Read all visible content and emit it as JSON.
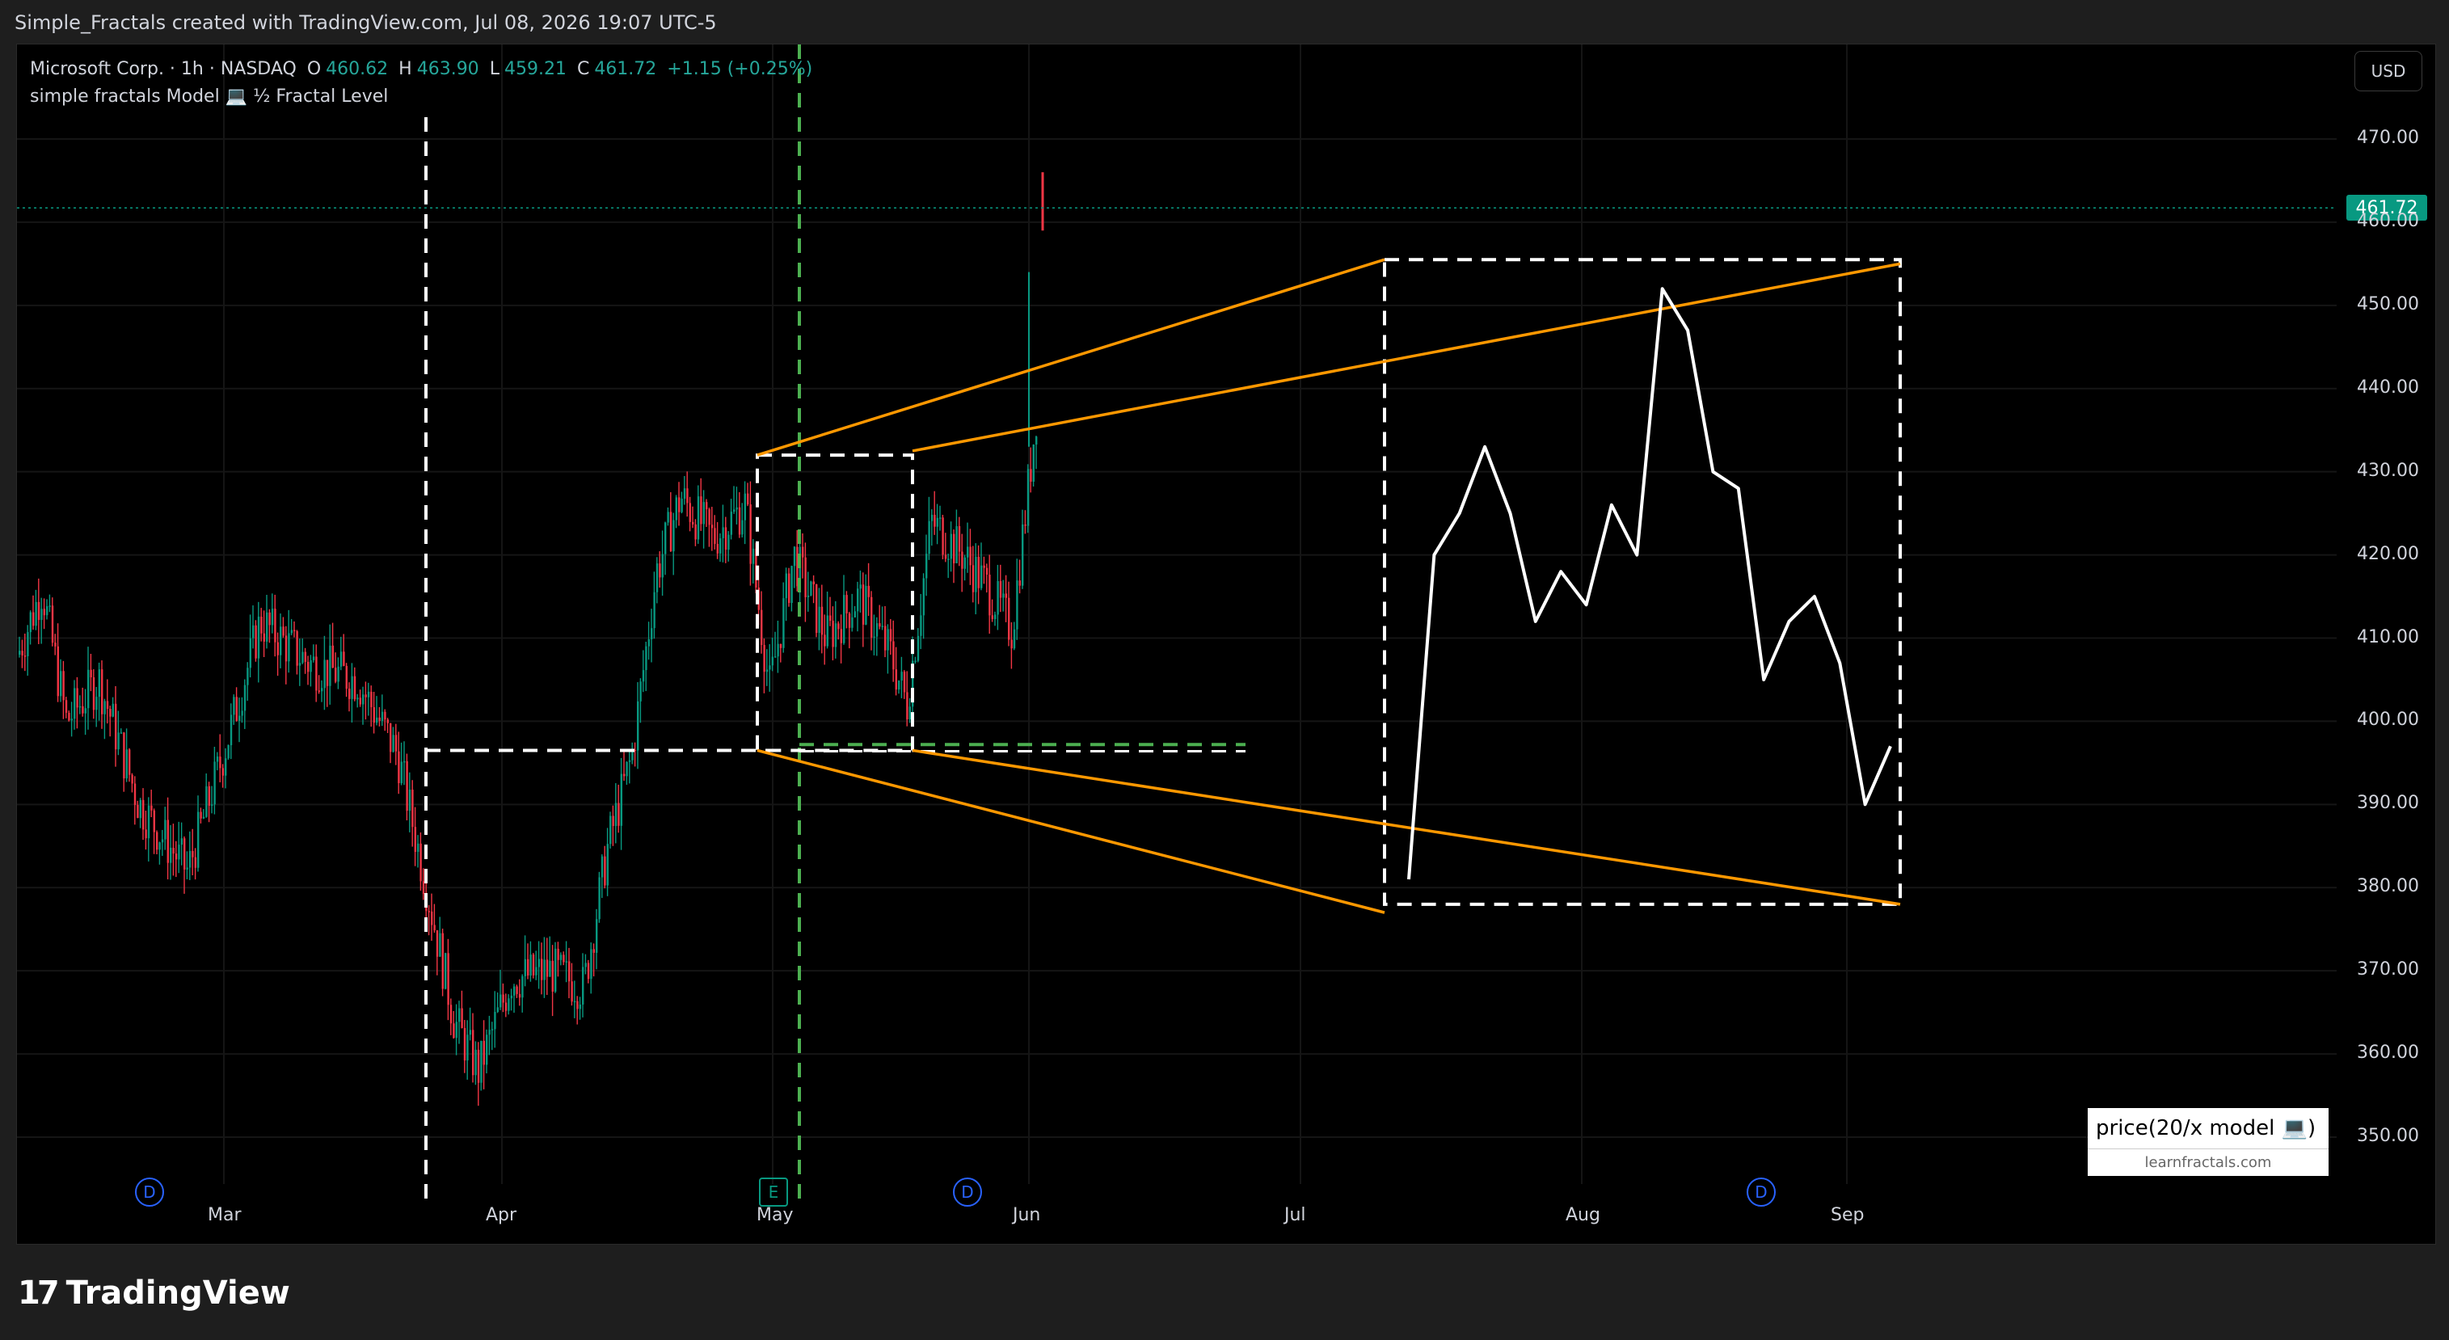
{
  "header": {
    "credit": "Simple_Fractals created with TradingView.com, Jul 08, 2026 19:07 UTC-5"
  },
  "legend": {
    "symbol": "Microsoft Corp. · 1h · NASDAQ",
    "o_label": "O",
    "o_value": "460.62",
    "h_label": "H",
    "h_value": "463.90",
    "l_label": "L",
    "l_value": "459.21",
    "c_label": "C",
    "c_value": "461.72",
    "change": "+1.15 (+0.25%)",
    "indicator": "simple fractals Model 💻 ½ Fractal Level"
  },
  "currency_button": "USD",
  "last_price_tag": "461.72",
  "y_axis_ticks": [
    "470.00",
    "460.00",
    "450.00",
    "440.00",
    "430.00",
    "420.00",
    "410.00",
    "400.00",
    "390.00",
    "380.00",
    "370.00",
    "360.00",
    "350.00"
  ],
  "x_axis_ticks": [
    "Mar",
    "Apr",
    "May",
    "Jun",
    "Jul",
    "Aug",
    "Sep"
  ],
  "events": [
    "D",
    "E",
    "D",
    "D"
  ],
  "model_box": {
    "title": "price(20/x model 💻)",
    "url": "learnfractals.com"
  },
  "footer": {
    "brand": "TradingView"
  },
  "colors": {
    "background": "#000000",
    "up_candle": "#089981",
    "down_candle": "#f23645",
    "orange_lines": "#ff9800",
    "white_dashed": "#ffffff",
    "green_dashed": "#4caf50",
    "price_tag": "#089981"
  },
  "chart_data": {
    "type": "line",
    "title": "",
    "price_range": [
      343,
      475
    ],
    "last_price": 461.72,
    "price_path_ohlc_summary": [
      {
        "period": "Feb late",
        "price": 415
      },
      {
        "period": "Mar mid",
        "price": 412
      },
      {
        "period": "Mar end",
        "price": 357
      },
      {
        "period": "Apr mid",
        "price": 430
      },
      {
        "period": "May mid",
        "price": 410
      },
      {
        "period": "Jun start",
        "price": 462
      }
    ],
    "fractal_projection": {
      "series_name": "",
      "values": [
        381,
        420,
        425,
        433,
        425,
        412,
        418,
        414,
        426,
        420,
        452,
        447,
        430,
        428,
        405,
        412,
        415,
        407,
        390,
        397
      ]
    }
  }
}
